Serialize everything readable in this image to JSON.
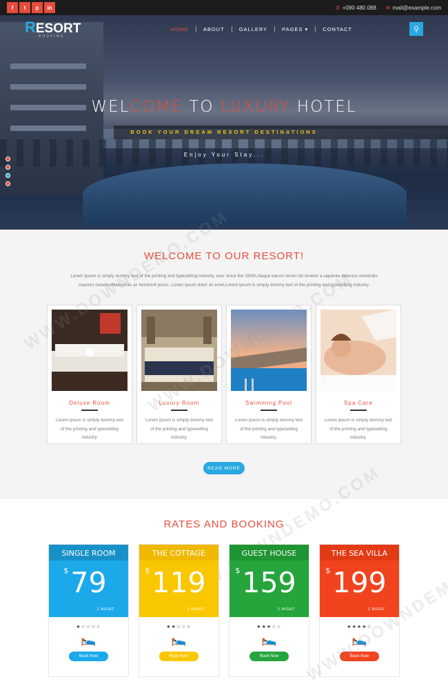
{
  "topbar": {
    "socials": [
      {
        "icon": "facebook-icon",
        "glyph": "f"
      },
      {
        "icon": "twitter-icon",
        "glyph": "t"
      },
      {
        "icon": "pinterest-icon",
        "glyph": "p"
      },
      {
        "icon": "linkedin-icon",
        "glyph": "in"
      }
    ],
    "phone": "+090 480 088",
    "email": "mail@example.com"
  },
  "logo": {
    "first_letter": "R",
    "rest": "ESORT",
    "tagline": "BOOKING"
  },
  "nav": {
    "items": [
      "HOME",
      "ABOUT",
      "GALLERY",
      "PAGES ▾",
      "CONTACT"
    ],
    "active": "HOME"
  },
  "hero": {
    "title_parts": [
      "WEL",
      "COME",
      " TO ",
      "LUXURY",
      " HOTEL"
    ],
    "subtitle": "BOOK YOUR DREAM RESORT DESTINATIONS",
    "tagline": "Enjoy Your Stay..."
  },
  "welcome": {
    "title": "WELCOME TO OUR RESORT!",
    "text": "Lorem Ipsum is simply dummy text of the printing and typesetting industry. ever since the 1500s.Itaque earum rerum hic tenetur a sapiente delectus reiciendis maiores hasellusMaecenas ac hendrerit purus. Lorem ipsum dolor sit amet.Lorem ipsum is simply dummy text of the printing and typesetting industry.",
    "rooms": [
      {
        "name": "Deluxe Room",
        "desc": "Lorem ipsum is simply dummy text of the printing and typesetting industry."
      },
      {
        "name": "Luxury Room",
        "desc": "Lorem ipsum is simply dummy text of the printing and typesetting industry."
      },
      {
        "name": "Swimming Pool",
        "desc": "Lorem ipsum is simply dummy text of the printing and typesetting industry."
      },
      {
        "name": "Spa Care",
        "desc": "Lorem ipsum is simply dummy text of the printing and typesetting industry."
      }
    ],
    "read_more": "READ MORE"
  },
  "rates": {
    "title": "RATES AND BOOKING",
    "cards": [
      {
        "title": "SINGLE ROOM",
        "currency": "$",
        "price": "79",
        "per": "1 NIGHT",
        "rating": 1,
        "color": "#1ba9ea",
        "header_color": "#1891c8",
        "button": "Book Now"
      },
      {
        "title": "THE COTTAGE",
        "currency": "$",
        "price": "119",
        "per": "1 NIGHT",
        "rating": 2,
        "color": "#f9c700",
        "header_color": "#f0b800",
        "button": "Book Now"
      },
      {
        "title": "GUEST HOUSE",
        "currency": "$",
        "price": "159",
        "per": "1 NIGHT",
        "rating": 3,
        "color": "#25a53c",
        "header_color": "#1e9433",
        "button": "Book Now"
      },
      {
        "title": "THE SEA VILLA",
        "currency": "$",
        "price": "199",
        "per": "1 NIGHT",
        "rating": 4,
        "color": "#f2431f",
        "header_color": "#e33a16",
        "button": "Book Now"
      }
    ]
  },
  "watermark": "WWW.DOWNDEMO.COM",
  "colors": {
    "accent_red": "#e74c3c",
    "accent_blue": "#29a9e1"
  }
}
